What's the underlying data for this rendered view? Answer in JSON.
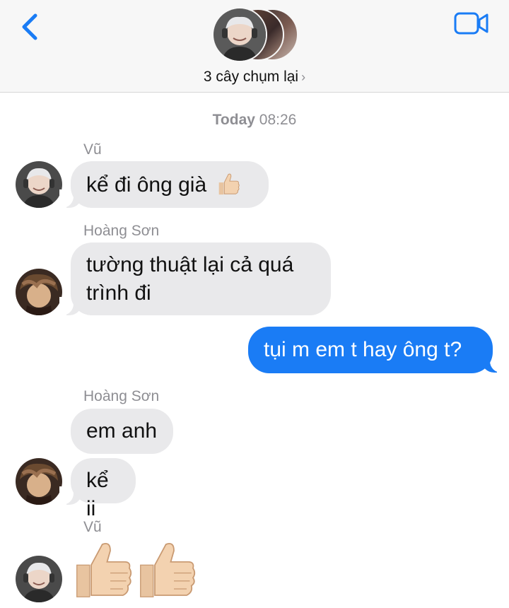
{
  "header": {
    "group_name": "3 cây chụm lại",
    "chevron": "›",
    "icons": {
      "back": "chevron-left-icon",
      "video": "video-camera-icon"
    },
    "accent": "#1a7cf5"
  },
  "timestamp": {
    "day": "Today",
    "time": "08:26"
  },
  "messages": [
    {
      "sender": "Vũ",
      "text": "kể đi ông già",
      "emoji": "thumbs-up"
    },
    {
      "sender": "Hoàng Sơn",
      "line1": "tường thuật lại cả quá",
      "line2": "trình đi"
    },
    {
      "text": "tụi m em t hay ông t?"
    },
    {
      "sender": "Hoàng Sơn",
      "text": "em anh"
    },
    {
      "text": "kể ii"
    },
    {
      "sender": "Vũ",
      "emoji": "two thumbs-up"
    }
  ],
  "colors": {
    "incoming": "#e9e9eb",
    "outgoing": "#1a7cf5",
    "meta": "#8e8e93"
  }
}
